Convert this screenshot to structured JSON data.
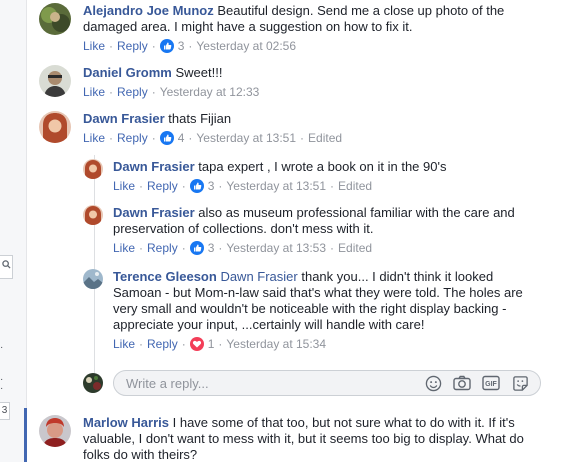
{
  "left_strip": {
    "marks": [
      "·",
      "·",
      "·"
    ],
    "search_icon": "search-icon",
    "number": "3"
  },
  "comments": [
    {
      "author": "Alejandro Joe Munoz",
      "text": "Beautiful design. Send me a close up photo of the damaged area. I might have a suggestion on how to fix it.",
      "like": "Like",
      "reply": "Reply",
      "reaction_count": "3",
      "timestamp": "Yesterday at 02:56",
      "reaction": "like-icon"
    },
    {
      "author": "Daniel Gromm",
      "text": "Sweet!!!",
      "like": "Like",
      "reply": "Reply",
      "timestamp": "Yesterday at 12:33"
    },
    {
      "author": "Dawn Frasier",
      "text": "thats Fijian",
      "like": "Like",
      "reply": "Reply",
      "reaction_count": "4",
      "timestamp": "Yesterday at 13:51",
      "edited": "Edited",
      "reaction": "like-icon"
    }
  ],
  "replies": [
    {
      "author": "Dawn Frasier",
      "text": "tapa expert , I wrote a book on it in the 90's",
      "like": "Like",
      "reply": "Reply",
      "reaction_count": "3",
      "timestamp": "Yesterday at 13:51",
      "edited": "Edited",
      "reaction": "like-icon"
    },
    {
      "author": "Dawn Frasier",
      "text_line1": "also as museum professional familiar with the care and",
      "text_line2": "preservation of collections. don't mess with it.",
      "like": "Like",
      "reply": "Reply",
      "reaction_count": "3",
      "timestamp": "Yesterday at 13:53",
      "edited": "Edited",
      "reaction": "like-icon"
    },
    {
      "author": "Terence Gleeson",
      "mention": "Dawn Frasier",
      "text_line1": "thank you... I didn't think it looked",
      "text_line2": "Samoan - but Mom-n-law said that's what they were told. The holes are",
      "text_line3": "very small and wouldn't be noticeable with the right display backing -",
      "text_line4": "appreciate your input, ...certainly will handle with care!",
      "like": "Like",
      "reply": "Reply",
      "reaction_count": "1",
      "timestamp": "Yesterday at 15:34",
      "reaction": "love-icon"
    }
  ],
  "reply_box": {
    "placeholder": "Write a reply...",
    "icons": [
      "emoji-icon",
      "camera-icon",
      "gif-icon",
      "sticker-icon"
    ]
  },
  "bottom_comment": {
    "author": "Marlow Harris",
    "text_line1": "I have some of that too, but not sure what to do with it. If it's",
    "text_line2": "valuable, I don't want to mess with it, but it seems too big to display. What do",
    "text_line3": "folks do with theirs?"
  },
  "colors": {
    "link": "#385898",
    "action": "#4267b2",
    "like_blue": "#1877f2",
    "love_red": "#f33e58",
    "meta_gray": "#90949c"
  }
}
